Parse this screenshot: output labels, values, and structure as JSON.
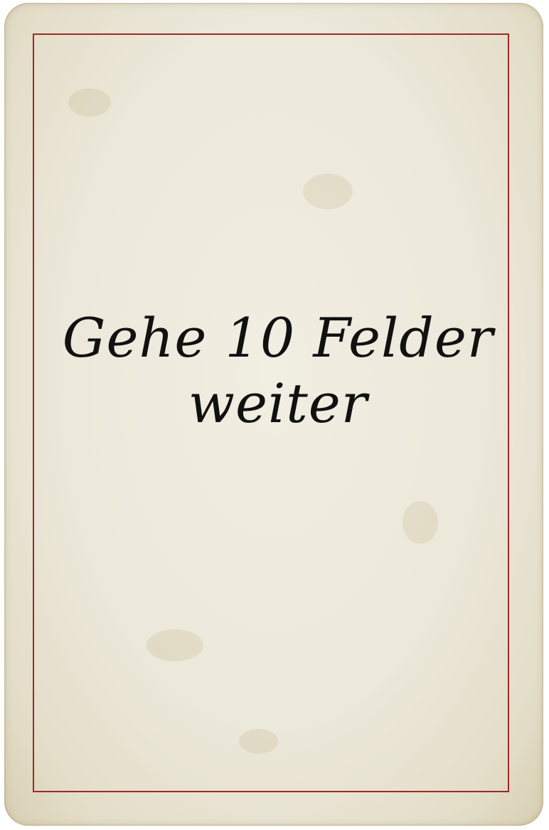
{
  "card": {
    "text_line_1": "Gehe 10 Felder",
    "text_line_2": "weiter",
    "colors": {
      "paper": "#ece8da",
      "border": "#9c2a2a",
      "text": "#111111"
    }
  }
}
